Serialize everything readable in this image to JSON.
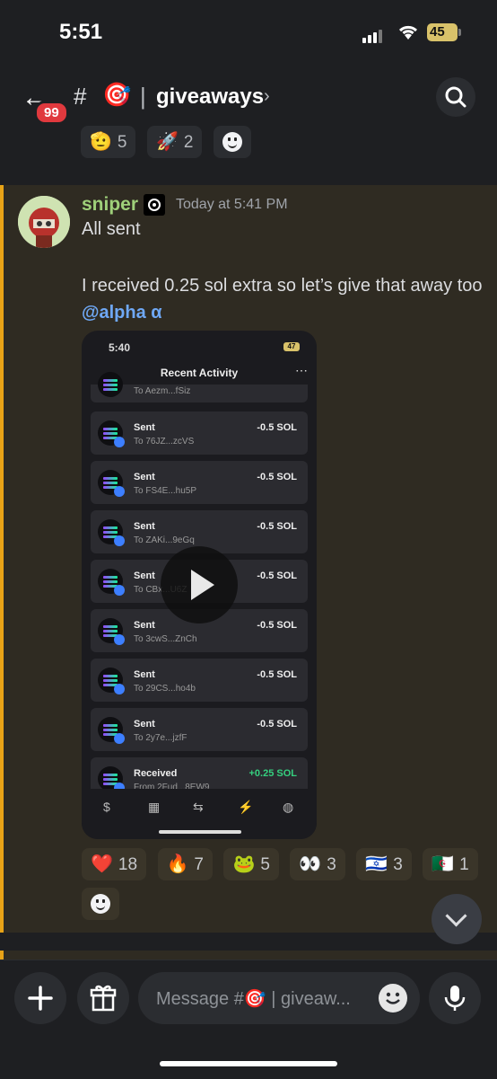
{
  "status_bar": {
    "time": "5:51",
    "battery": "45"
  },
  "header": {
    "back_badge": "99",
    "hash": "#",
    "channel_emoji": "🎯",
    "separator": "|",
    "channel_name": "giveaways",
    "chevron": "›"
  },
  "previous_reactions": [
    {
      "emoji": "🫡",
      "count": "5"
    },
    {
      "emoji": "🚀",
      "count": "2"
    }
  ],
  "message": {
    "username": "sniper",
    "timestamp": "Today at 5:41 PM",
    "line1": "All sent",
    "line2": "I received 0.25 sol extra so let’s give that away too",
    "mention": "@alpha α",
    "attachment": {
      "time": "5:40",
      "battery": "47",
      "title": "Recent Activity",
      "partial_top": "To Aezm...fSiz",
      "transactions": [
        {
          "kind": "Sent",
          "detail": "To 76JZ...zcVS",
          "amount": "-0.5 SOL"
        },
        {
          "kind": "Sent",
          "detail": "To FS4E...hu5P",
          "amount": "-0.5 SOL"
        },
        {
          "kind": "Sent",
          "detail": "To ZAKi...9eGq",
          "amount": "-0.5 SOL"
        },
        {
          "kind": "Sent",
          "detail": "To CBx...U6Z",
          "amount": "-0.5 SOL"
        },
        {
          "kind": "Sent",
          "detail": "To 3cwS...ZnCh",
          "amount": "-0.5 SOL"
        },
        {
          "kind": "Sent",
          "detail": "To 29CS...ho4b",
          "amount": "-0.5 SOL"
        },
        {
          "kind": "Sent",
          "detail": "To 2y7e...jzfF",
          "amount": "-0.5 SOL"
        },
        {
          "kind": "Received",
          "detail": "From 2Fud...8EW9",
          "amount": "+0.25 SOL"
        }
      ],
      "nav": [
        "$",
        "▦",
        "⇆",
        "⚡",
        "◍"
      ]
    },
    "reactions": [
      {
        "emoji": "❤️",
        "count": "18"
      },
      {
        "emoji": "🔥",
        "count": "7"
      },
      {
        "emoji": "🐸",
        "count": "5"
      },
      {
        "emoji": "👀",
        "count": "3"
      },
      {
        "emoji": "🇮🇱",
        "count": "3"
      },
      {
        "emoji": "🇩🇿",
        "count": "1"
      }
    ]
  },
  "composer": {
    "placeholder": "Message #🎯 | giveaw..."
  }
}
